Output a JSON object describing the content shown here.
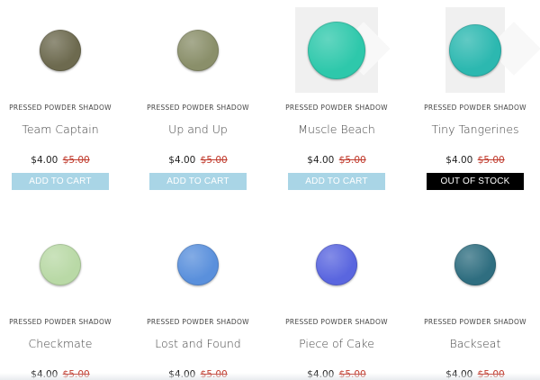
{
  "products": [
    {
      "category": "PRESSED POWDER SHADOW",
      "name": "Team Captain",
      "price": "$4.00",
      "old_price": "$5.00",
      "button": "ADD TO CART",
      "color": "#6d6a4f",
      "status": "add"
    },
    {
      "category": "PRESSED POWDER SHADOW",
      "name": "Up and Up",
      "price": "$4.00",
      "old_price": "$5.00",
      "button": "ADD TO CART",
      "color": "#8a8f6a",
      "status": "add"
    },
    {
      "category": "PRESSED POWDER SHADOW",
      "name": "Muscle Beach",
      "price": "$4.00",
      "old_price": "$5.00",
      "button": "ADD TO CART",
      "color": "#2ec8ab",
      "status": "add"
    },
    {
      "category": "PRESSED POWDER SHADOW",
      "name": "Tiny Tangerines",
      "price": "$4.00",
      "old_price": "$5.00",
      "button": "OUT OF STOCK",
      "color": "#2cb8b0",
      "status": "oos"
    },
    {
      "category": "PRESSED POWDER SHADOW",
      "name": "Checkmate",
      "price": "$4.00",
      "old_price": "$5.00",
      "color": "#b9d9a6"
    },
    {
      "category": "PRESSED POWDER SHADOW",
      "name": "Lost and Found",
      "price": "$4.00",
      "old_price": "$5.00",
      "color": "#5a90dc"
    },
    {
      "category": "PRESSED POWDER SHADOW",
      "name": "Piece of Cake",
      "price": "$4.00",
      "old_price": "$5.00",
      "color": "#5a66df"
    },
    {
      "category": "PRESSED POWDER SHADOW",
      "name": "Backseat",
      "price": "$4.00",
      "old_price": "$5.00",
      "color": "#2f6e80"
    }
  ]
}
